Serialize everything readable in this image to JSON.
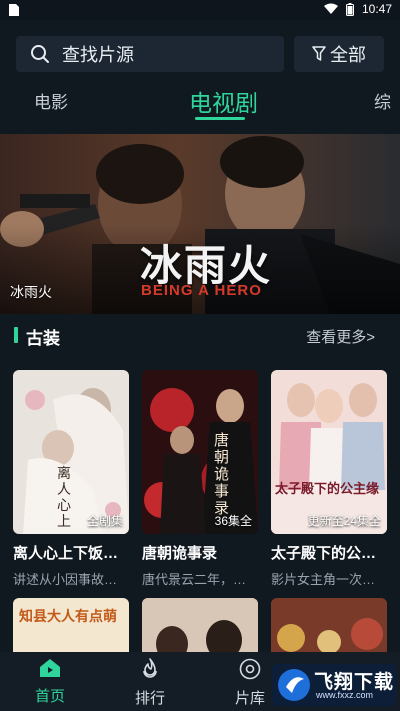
{
  "status_bar": {
    "time": "10:47"
  },
  "search": {
    "placeholder_text": "查找片源",
    "filter_label": "全部"
  },
  "tabs": [
    {
      "label": "电影",
      "active": false
    },
    {
      "label": "电视剧",
      "active": true
    },
    {
      "label": "综",
      "active": false
    }
  ],
  "banner": {
    "caption": "冰雨火",
    "poster_title": "冰雨火",
    "poster_subtitle": "BEING A HERO"
  },
  "section": {
    "title": "古装",
    "more_label": "查看更多>"
  },
  "cards": [
    {
      "title": "离人心上下饭…",
      "desc": "讲述从小因事故…",
      "badge": "全剧集",
      "poster_text": "离人心上"
    },
    {
      "title": "唐朝诡事录",
      "desc": "唐代景云二年，…",
      "badge": "36集全",
      "poster_text": "唐朝诡事录"
    },
    {
      "title": "太子殿下的公…",
      "desc": "影片女主角一次…",
      "badge": "更新至24集全",
      "poster_text": "太子殿下的公主缘"
    }
  ],
  "row2_posters": [
    {
      "poster_text": "知县大人有点萌"
    },
    {
      "poster_text": ""
    },
    {
      "poster_text": ""
    }
  ],
  "bottom_nav": [
    {
      "label": "首页",
      "active": true
    },
    {
      "label": "排行",
      "active": false
    },
    {
      "label": "片库",
      "active": false
    }
  ],
  "watermark": {
    "text": "飞翔下载",
    "sub": "www.fxxz.com"
  },
  "colors": {
    "accent": "#2fd59a",
    "background": "#101820",
    "surface": "#1c2733"
  }
}
